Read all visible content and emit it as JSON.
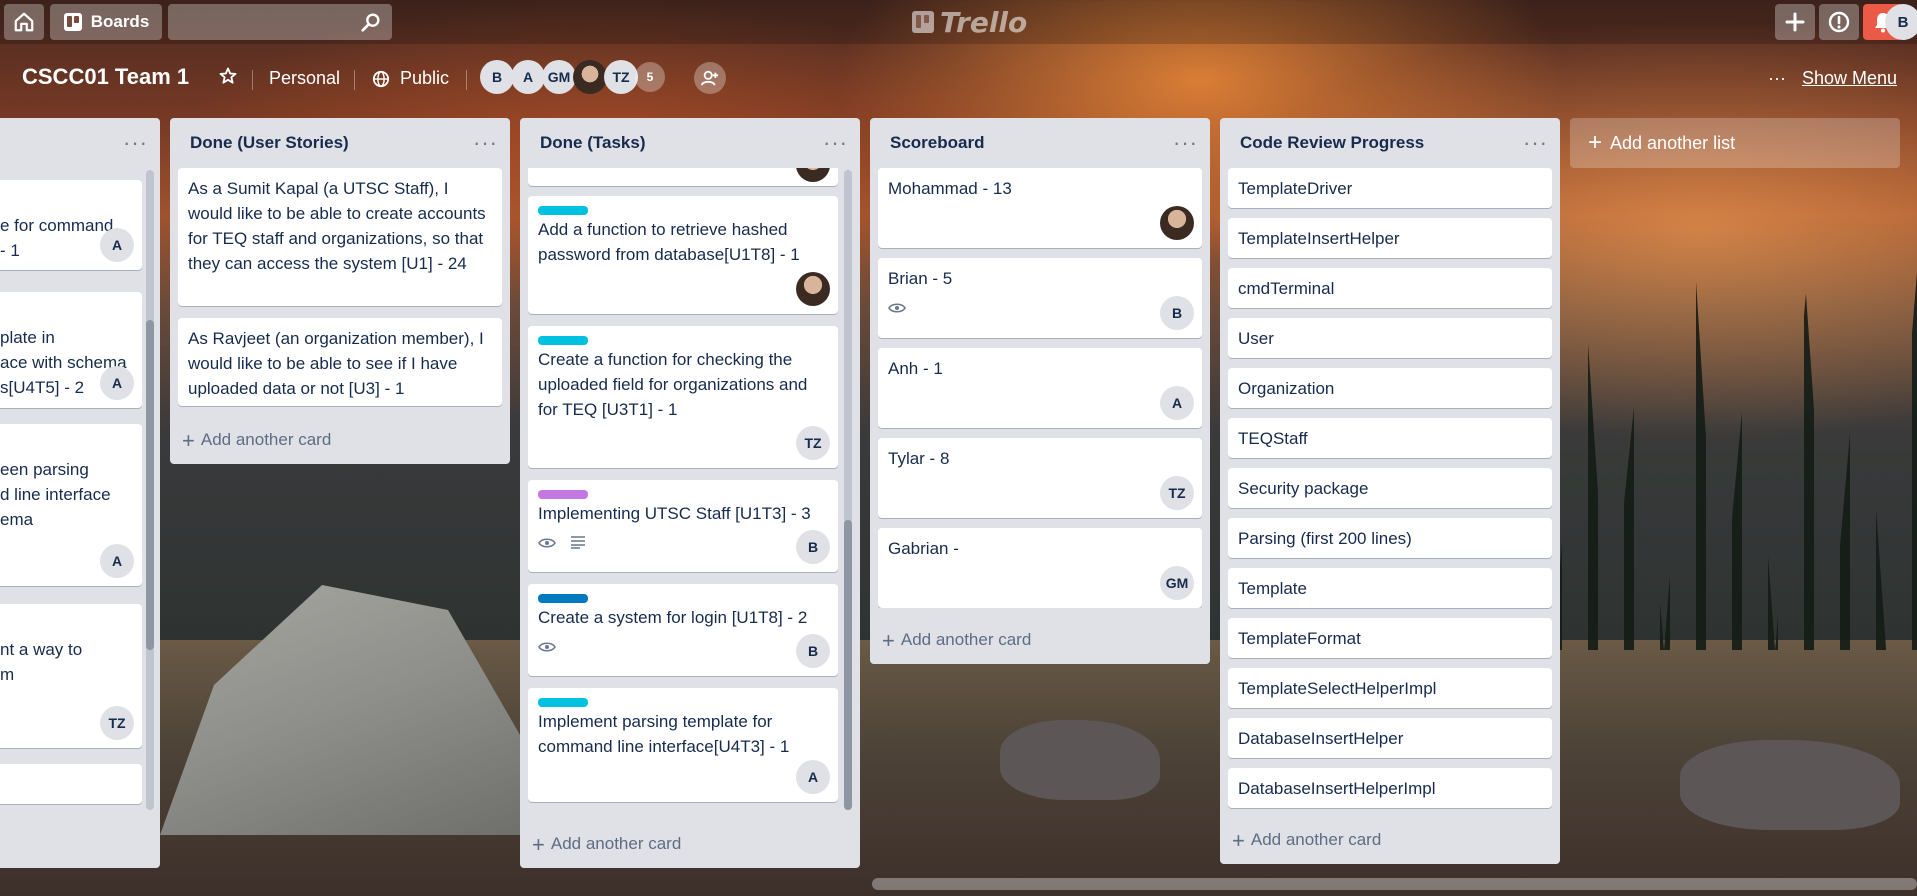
{
  "topbar": {
    "boards_label": "Boards",
    "logo_text": "Trello",
    "avatar_initial": "B",
    "bell_color": "#eb5a46"
  },
  "board": {
    "title": "CSCC01 Team 1",
    "personal_label": "Personal",
    "public_label": "Public",
    "members": [
      "B",
      "A",
      "GM",
      "",
      "TZ"
    ],
    "member_count": "5",
    "show_menu_label": "Show Menu",
    "menu_dots": "···"
  },
  "lists": {
    "partial": {
      "cards": [
        {
          "text": "e for command\n- 1",
          "member": "A"
        },
        {
          "text": "plate in\nace with schema\ns[U4T5] - 2",
          "member": "A"
        },
        {
          "text": "een parsing\nd line interface\nema",
          "member": "A"
        },
        {
          "text": "nt a way to\nm",
          "member": "TZ"
        }
      ]
    },
    "done_stories": {
      "title": "Done (User Stories)",
      "cards": [
        {
          "text": "As a Sumit Kapal (a UTSC Staff), I would like to be able to create accounts for TEQ staff and organizations, so that they can access the system [U1] - 24"
        },
        {
          "text": "As Ravjeet (an organization member), I would like to be able to see if I have uploaded data or not [U3] - 1"
        }
      ],
      "add_card": "Add another card"
    },
    "done_tasks": {
      "title": "Done (Tasks)",
      "cards": [
        {
          "text": "Add a function to retrieve hashed password from database[U1T8] - 1",
          "label_color": "#00c2e0",
          "member": "photo"
        },
        {
          "text": "Create a function for checking the uploaded field for organizations and for TEQ [U3T1] - 1",
          "label_color": "#00c2e0",
          "member": "TZ"
        },
        {
          "text": "Implementing UTSC Staff [U1T3] - 3",
          "label_color": "#c377e0",
          "member": "B"
        },
        {
          "text": "Create a system for login [U1T8] - 2",
          "label_color": "#0079bf",
          "member": "B"
        },
        {
          "text": "Implement parsing template for command line interface[U4T3] - 1",
          "label_color": "#00c2e0",
          "member": "A"
        }
      ],
      "add_card": "Add another card"
    },
    "scoreboard": {
      "title": "Scoreboard",
      "cards": [
        {
          "text": "Mohammad - 13",
          "member": "photo"
        },
        {
          "text": "Brian - 5",
          "member": "B"
        },
        {
          "text": "Anh - 1",
          "member": "A"
        },
        {
          "text": "Tylar - 8",
          "member": "TZ"
        },
        {
          "text": "Gabrian -",
          "member": "GM"
        }
      ],
      "add_card": "Add another card"
    },
    "code_review": {
      "title": "Code Review Progress",
      "cards": [
        "TemplateDriver",
        "TemplateInsertHelper",
        "cmdTerminal",
        "User",
        "Organization",
        "TEQStaff",
        "Security package",
        "Parsing (first 200 lines)",
        "Template",
        "TemplateFormat",
        "TemplateSelectHelperImpl",
        "DatabaseInsertHelper",
        "DatabaseInsertHelperImpl"
      ],
      "add_card": "Add another card"
    }
  },
  "add_list_label": "Add another list"
}
